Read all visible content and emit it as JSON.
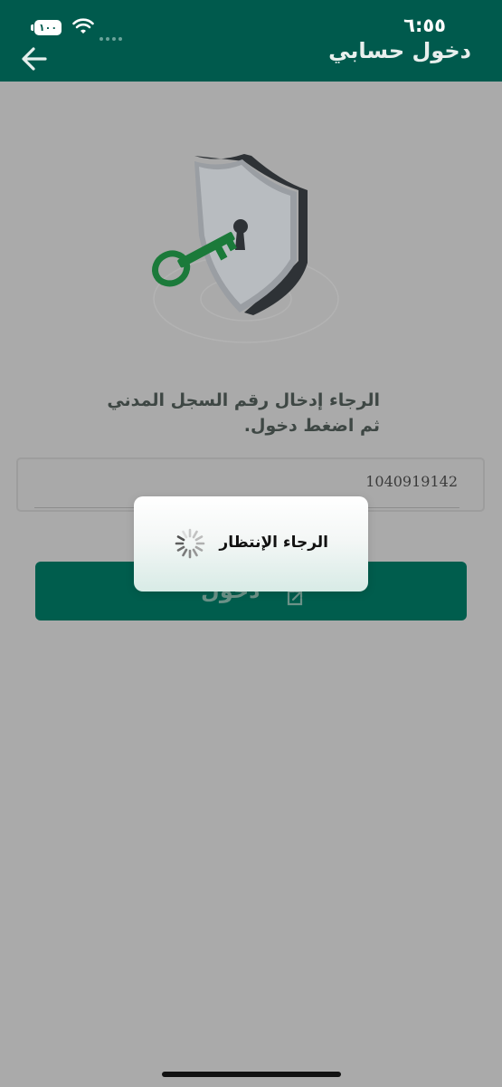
{
  "status_bar": {
    "time": "٦:٥٥",
    "battery": "١٠٠"
  },
  "header": {
    "title": "دخول حسابي"
  },
  "instruction": {
    "line1": "الرجاء إدخال رقم السجل المدني",
    "line2": "ثم اضغط دخول."
  },
  "civil_id_input": {
    "value": "1040919142"
  },
  "login_button": {
    "label": "دخول"
  },
  "loading_dialog": {
    "message": "الرجاء الإنتظار"
  },
  "colors": {
    "header_bg": "#005a4d",
    "overlay_bg": "#aaaaaa",
    "button_bg": "#005d4d",
    "key_green": "#1b7a3a"
  }
}
